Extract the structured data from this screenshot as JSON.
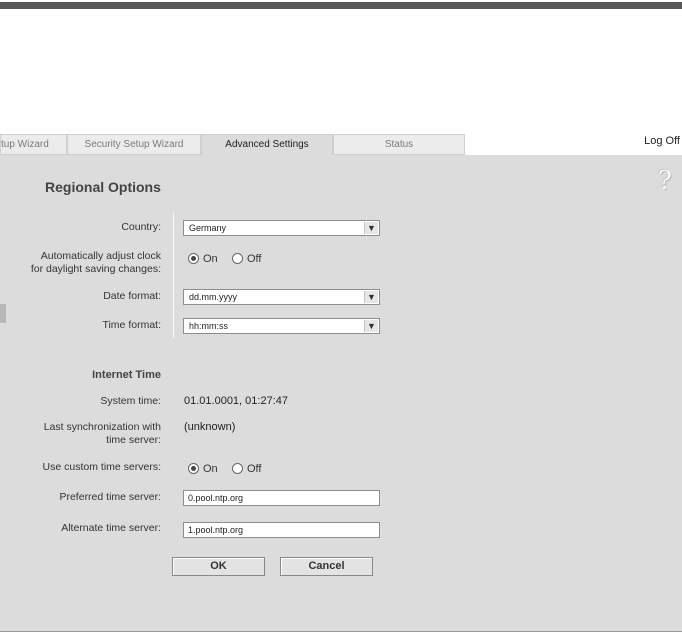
{
  "tabs": [
    {
      "label": "tup Wizard"
    },
    {
      "label": "Security Setup Wizard"
    },
    {
      "label": "Advanced Settings"
    },
    {
      "label": "Status"
    }
  ],
  "header": {
    "logoff_label": "Log Off",
    "help_icon": "?"
  },
  "regional": {
    "title": "Regional Options",
    "country_label": "Country:",
    "country_value": "Germany",
    "dst_label_line1": "Automatically adjust clock",
    "dst_label_line2": "for daylight saving changes:",
    "dst_on": "On",
    "dst_off": "Off",
    "dst_selected": "On",
    "date_label": "Date format:",
    "date_value": "dd.mm.yyyy",
    "time_label": "Time format:",
    "time_value": "hh:mm:ss"
  },
  "internet_time": {
    "title": "Internet Time",
    "system_time_label": "System time:",
    "system_time_value": "01.01.0001, 01:27:47",
    "last_sync_label_line1": "Last synchronization with",
    "last_sync_label_line2": "time server:",
    "last_sync_value": "(unknown)",
    "custom_label": "Use custom time servers:",
    "custom_on": "On",
    "custom_off": "Off",
    "custom_selected": "On",
    "preferred_label": "Preferred time server:",
    "preferred_value": "0.pool.ntp.org",
    "alternate_label": "Alternate time server:",
    "alternate_value": "1.pool.ntp.org"
  },
  "buttons": {
    "ok": "OK",
    "cancel": "Cancel"
  }
}
